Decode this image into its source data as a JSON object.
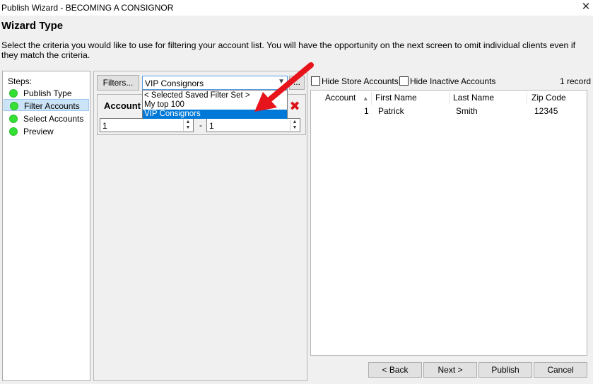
{
  "window": {
    "title": "Publish Wizard - BECOMING A CONSIGNOR",
    "close_glyph": "✕"
  },
  "heading": "Wizard Type",
  "description": "Select the criteria you would like to use for filtering your account list.  You will have the opportunity on the next screen to omit individual clients even if they match the criteria.",
  "steps": {
    "label": "Steps:",
    "items": [
      {
        "label": "Publish Type",
        "status_color": "#35e035"
      },
      {
        "label": "Filter Accounts",
        "status_color": "#35e035",
        "active": true
      },
      {
        "label": "Select Accounts",
        "status_color": "#35e035"
      },
      {
        "label": "Preview",
        "status_color": "#35e035"
      }
    ]
  },
  "filter": {
    "filters_button": "Filters...",
    "combo_value": "VIP Consignors",
    "ellipsis_button": "...",
    "options": [
      "< Selected Saved Filter Set >",
      "My top 100",
      "VIP Consignors"
    ],
    "selected_index": 2,
    "box_title": "Account",
    "range_from": "1",
    "range_separator": "-",
    "range_to": "1"
  },
  "accounts": {
    "hide_store_label": "Hide Store Accounts",
    "hide_inactive_label": "Hide Inactive Accounts",
    "record_count": "1 record",
    "columns": [
      "Account",
      "First Name",
      "Last Name",
      "Zip Code"
    ],
    "rows": [
      {
        "account": "1",
        "first_name": "Patrick",
        "last_name": "Smith",
        "zip": "12345"
      }
    ]
  },
  "nav": {
    "back": "< Back",
    "next": "Next >",
    "publish": "Publish",
    "cancel": "Cancel"
  },
  "colors": {
    "accent": "#0078d7",
    "annotation_arrow": "#e8141c",
    "delete": "#d9141b"
  }
}
